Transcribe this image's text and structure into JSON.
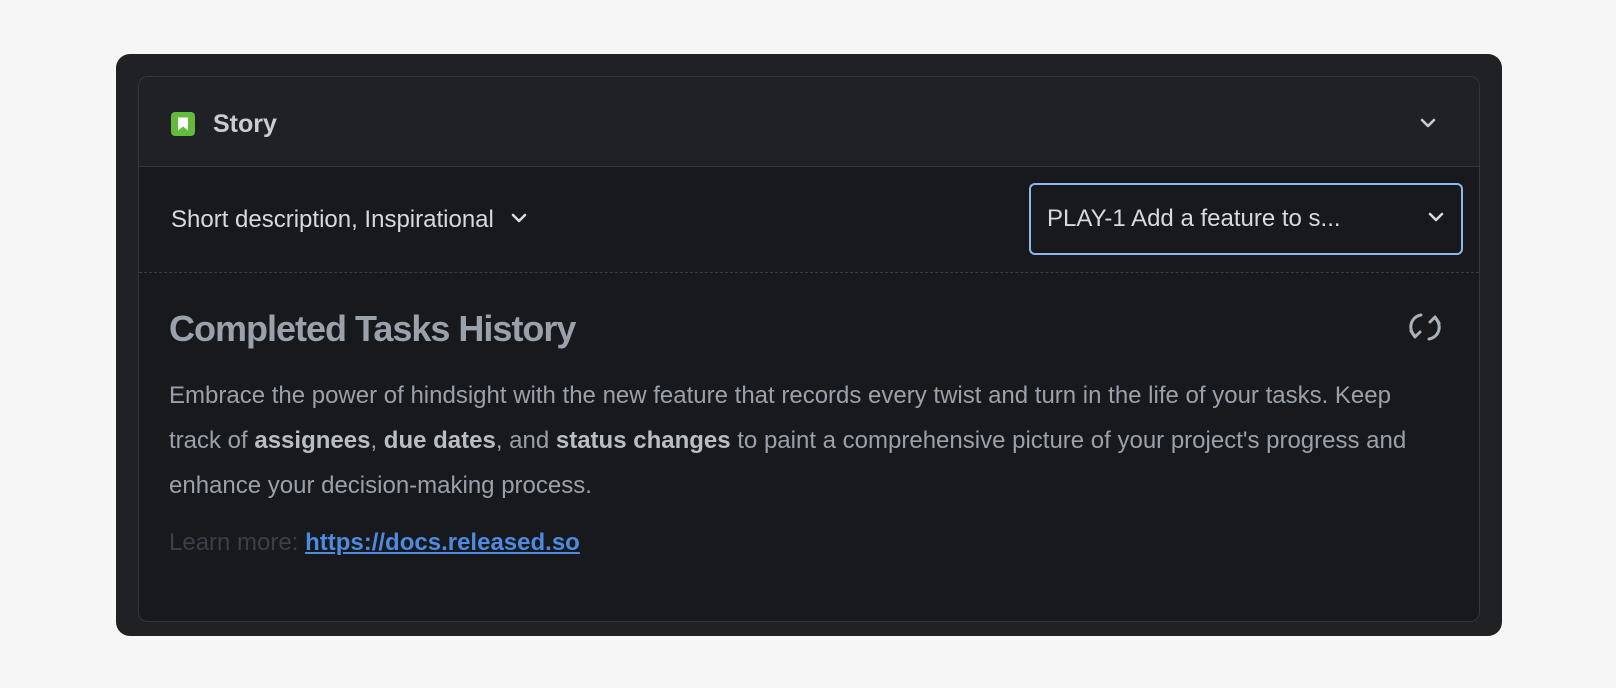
{
  "header": {
    "title": "Story",
    "icon": "bookmark-icon",
    "icon_color": "#63ba3c"
  },
  "toolbar": {
    "left_selector": "Short description, Inspirational",
    "right_selector": "PLAY-1 Add a feature to s...",
    "focus_color": "#8fb8f0"
  },
  "content": {
    "title": "Completed Tasks History",
    "refresh_icon": "refresh-icon",
    "description": {
      "part1": "Embrace the power of hindsight with the new feature that records every twist and turn in the life of your tasks. Keep track of ",
      "bold1": "assignees",
      "sep1": ", ",
      "bold2": "due dates",
      "sep2": ", and ",
      "bold3": "status changes",
      "part2": " to paint a comprehensive picture of your project's progress and enhance your decision-making process."
    },
    "learn_more_label": "Learn more: ",
    "learn_more_link": "https://docs.released.so",
    "link_color": "#4d8ae0"
  }
}
